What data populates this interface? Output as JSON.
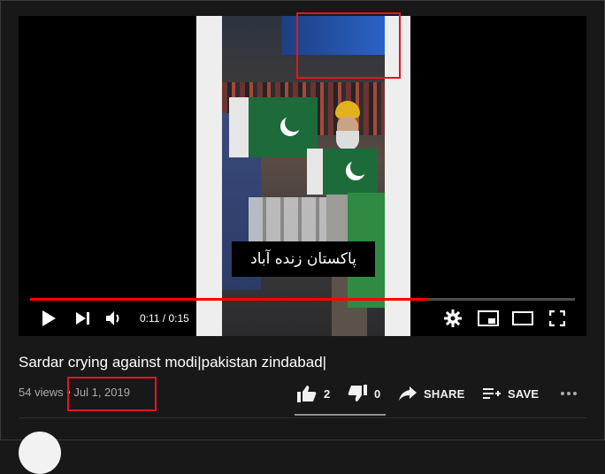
{
  "video": {
    "subtitle": "پاکستان زنده آباد",
    "current_time": "0:11",
    "separator": " / ",
    "duration": "0:15",
    "progress": 0.73
  },
  "info": {
    "title": "Sardar crying against modi|pakistan zindabad|",
    "views": "54 views",
    "dot": " • ",
    "date": "Jul 1, 2019"
  },
  "actions": {
    "like_count": "2",
    "dislike_count": "0",
    "share_label": "SHARE",
    "save_label": "SAVE"
  },
  "colors": {
    "annotation": "#e0171f",
    "progress": "#ff0000"
  },
  "icons": [
    "play-icon",
    "next-icon",
    "volume-icon",
    "settings-icon",
    "miniplayer-icon",
    "theater-icon",
    "fullscreen-icon",
    "like-icon",
    "dislike-icon",
    "share-icon",
    "save-icon",
    "more-icon"
  ]
}
